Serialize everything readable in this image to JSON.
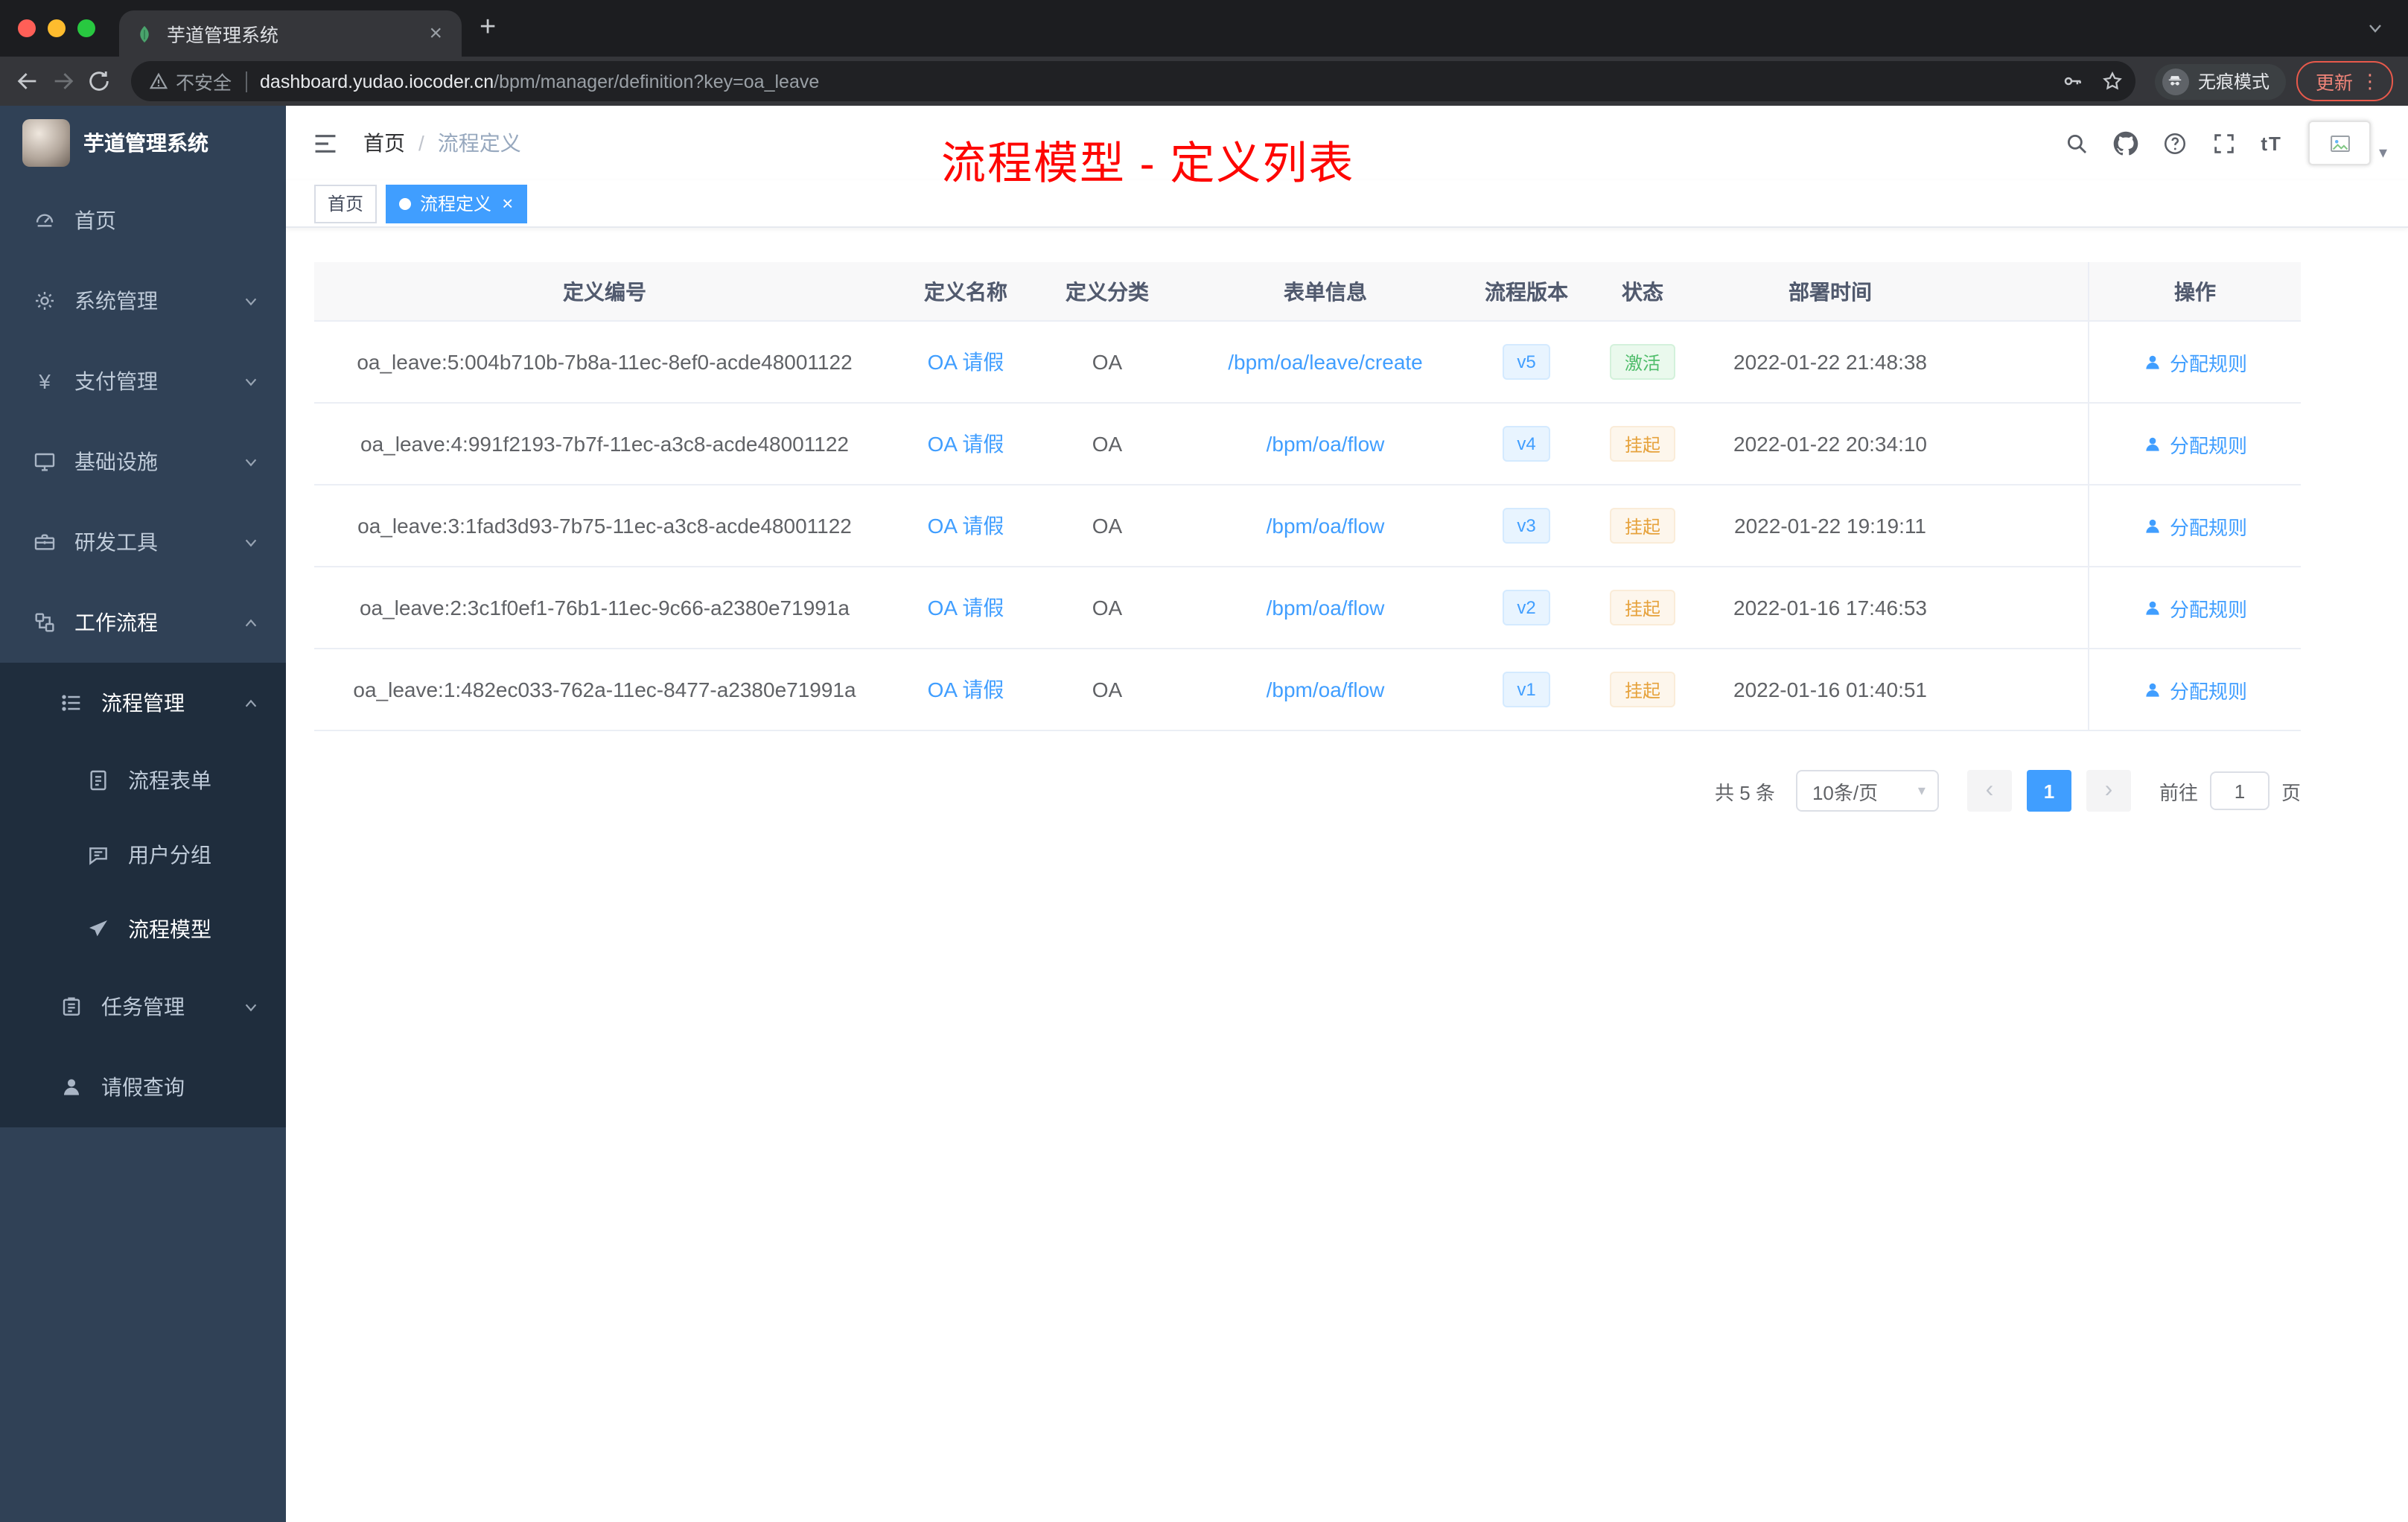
{
  "browser": {
    "tab_title": "芋道管理系统",
    "security_label": "不安全",
    "url_host": "dashboard.yudao.iocoder.cn",
    "url_path": "/bpm/manager/definition?key=oa_leave",
    "incognito_label": "无痕模式",
    "update_label": "更新"
  },
  "icons": {
    "close": "×",
    "plus": "+",
    "kebab": "⋮",
    "caret_down": "▾",
    "font_size": "tT",
    "prev": "‹",
    "next": "›",
    "yen": "¥",
    "breadcrumb_sep": "/"
  },
  "sidebar": {
    "logo_title": "芋道管理系统",
    "items": [
      {
        "label": "首页"
      },
      {
        "label": "系统管理"
      },
      {
        "label": "支付管理"
      },
      {
        "label": "基础设施"
      },
      {
        "label": "研发工具"
      },
      {
        "label": "工作流程"
      }
    ],
    "sub": [
      {
        "label": "流程管理"
      },
      {
        "label": "流程表单"
      },
      {
        "label": "用户分组"
      },
      {
        "label": "流程模型"
      },
      {
        "label": "任务管理"
      },
      {
        "label": "请假查询"
      }
    ]
  },
  "header": {
    "breadcrumb": [
      "首页",
      "流程定义"
    ],
    "annotation": "流程模型 - 定义列表"
  },
  "tags": {
    "items": [
      {
        "label": "首页"
      },
      {
        "label": "流程定义"
      }
    ]
  },
  "table": {
    "columns": [
      "定义编号",
      "定义名称",
      "定义分类",
      "表单信息",
      "流程版本",
      "状态",
      "部署时间",
      "操作"
    ],
    "rows": [
      {
        "id": "oa_leave:5:004b710b-7b8a-11ec-8ef0-acde48001122",
        "name": "OA 请假",
        "category": "OA",
        "form": "/bpm/oa/leave/create",
        "version": "v5",
        "status": "激活",
        "time": "2022-01-22 21:48:38",
        "action": "分配规则"
      },
      {
        "id": "oa_leave:4:991f2193-7b7f-11ec-a3c8-acde48001122",
        "name": "OA 请假",
        "category": "OA",
        "form": "/bpm/oa/flow",
        "version": "v4",
        "status": "挂起",
        "time": "2022-01-22 20:34:10",
        "action": "分配规则"
      },
      {
        "id": "oa_leave:3:1fad3d93-7b75-11ec-a3c8-acde48001122",
        "name": "OA 请假",
        "category": "OA",
        "form": "/bpm/oa/flow",
        "version": "v3",
        "status": "挂起",
        "time": "2022-01-22 19:19:11",
        "action": "分配规则"
      },
      {
        "id": "oa_leave:2:3c1f0ef1-76b1-11ec-9c66-a2380e71991a",
        "name": "OA 请假",
        "category": "OA",
        "form": "/bpm/oa/flow",
        "version": "v2",
        "status": "挂起",
        "time": "2022-01-16 17:46:53",
        "action": "分配规则"
      },
      {
        "id": "oa_leave:1:482ec033-762a-11ec-8477-a2380e71991a",
        "name": "OA 请假",
        "category": "OA",
        "form": "/bpm/oa/flow",
        "version": "v1",
        "status": "挂起",
        "time": "2022-01-16 01:40:51",
        "action": "分配规则"
      }
    ]
  },
  "pagination": {
    "total": "共 5 条",
    "page_size": "10条/页",
    "current_page": "1",
    "goto_label": "前往",
    "goto_value": "1",
    "page_unit": "页"
  },
  "colors": {
    "accent": "#409eff",
    "success": "#67c23a",
    "warning": "#e6a23c",
    "annotation": "#ff0000",
    "sidebar_bg": "#304156",
    "submenu_bg": "#1f2d3d",
    "active_tag": "#409eff"
  }
}
